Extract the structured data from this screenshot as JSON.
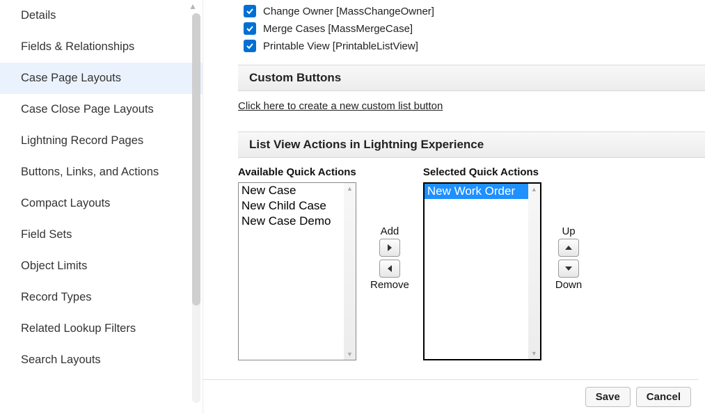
{
  "sidebar": {
    "items": [
      {
        "label": "Details"
      },
      {
        "label": "Fields & Relationships"
      },
      {
        "label": "Case Page Layouts",
        "active": true
      },
      {
        "label": "Case Close Page Layouts"
      },
      {
        "label": "Lightning Record Pages"
      },
      {
        "label": "Buttons, Links, and Actions"
      },
      {
        "label": "Compact Layouts"
      },
      {
        "label": "Field Sets"
      },
      {
        "label": "Object Limits"
      },
      {
        "label": "Record Types"
      },
      {
        "label": "Related Lookup Filters"
      },
      {
        "label": "Search Layouts"
      }
    ]
  },
  "standard_buttons": [
    {
      "label": "Change Owner [MassChangeOwner]",
      "checked": true
    },
    {
      "label": "Merge Cases [MassMergeCase]",
      "checked": true
    },
    {
      "label": "Printable View [PrintableListView]",
      "checked": true
    }
  ],
  "sections": {
    "custom_buttons_header": "Custom Buttons",
    "custom_buttons_link": "Click here to create a new custom list button",
    "lvae_header": "List View Actions in Lightning Experience"
  },
  "picklists": {
    "available_label": "Available Quick Actions",
    "selected_label": "Selected Quick Actions",
    "available": [
      "New Case",
      "New Child Case",
      "New Case Demo"
    ],
    "selected": [
      "New Work Order"
    ],
    "add_label": "Add",
    "remove_label": "Remove",
    "up_label": "Up",
    "down_label": "Down"
  },
  "footer": {
    "save": "Save",
    "cancel": "Cancel"
  }
}
